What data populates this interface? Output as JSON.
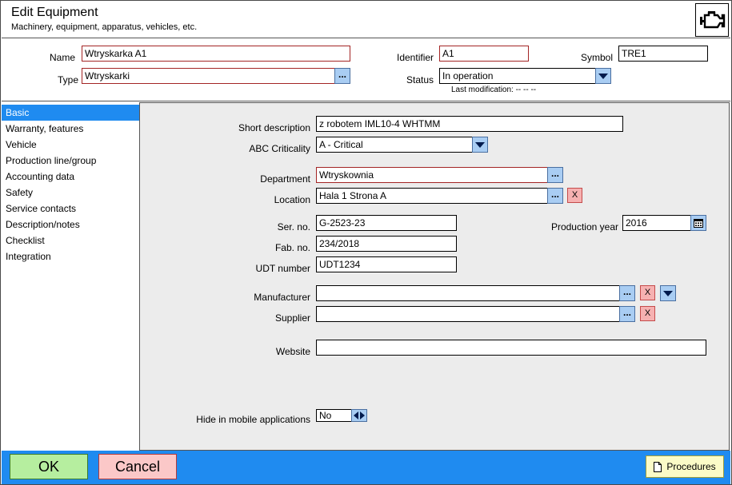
{
  "header": {
    "title": "Edit Equipment",
    "subtitle": "Machinery, equipment, apparatus, vehicles, etc.",
    "icon": "engine-icon"
  },
  "top_form": {
    "name_label": "Name",
    "name_value": "Wtryskarka A1",
    "type_label": "Type",
    "type_value": "Wtryskarki",
    "identifier_label": "Identifier",
    "identifier_value": "A1",
    "symbol_label": "Symbol",
    "symbol_value": "TRE1",
    "status_label": "Status",
    "status_value": "In operation",
    "last_modification": "Last modification: -- -- --"
  },
  "sidebar": {
    "items": [
      {
        "label": "Basic",
        "active": true
      },
      {
        "label": "Warranty, features",
        "active": false
      },
      {
        "label": "Vehicle",
        "active": false
      },
      {
        "label": "Production line/group",
        "active": false
      },
      {
        "label": "Accounting data",
        "active": false
      },
      {
        "label": "Safety",
        "active": false
      },
      {
        "label": "Service contacts",
        "active": false
      },
      {
        "label": "Description/notes",
        "active": false
      },
      {
        "label": "Checklist",
        "active": false
      },
      {
        "label": "Integration",
        "active": false
      }
    ]
  },
  "basic": {
    "short_description_label": "Short description",
    "short_description_value": "z robotem IML10-4  WHTMM",
    "abc_label": "ABC Criticality",
    "abc_value": "A - Critical",
    "department_label": "Department",
    "department_value": "Wtryskownia",
    "location_label": "Location",
    "location_value": "Hala 1 Strona A",
    "serno_label": "Ser. no.",
    "serno_value": "G-2523-23",
    "fabno_label": "Fab. no.",
    "fabno_value": "234/2018",
    "udt_label": "UDT number",
    "udt_value": "UDT1234",
    "production_year_label": "Production year",
    "production_year_value": "2016",
    "manufacturer_label": "Manufacturer",
    "manufacturer_value": "",
    "supplier_label": "Supplier",
    "supplier_value": "",
    "website_label": "Website",
    "website_value": "",
    "hide_label": "Hide in mobile applications",
    "hide_value": "No"
  },
  "buttons": {
    "dots": "...",
    "clear": "X",
    "ok": "OK",
    "cancel": "Cancel",
    "procedures": "Procedures"
  },
  "colors": {
    "accent": "#1f8bf0",
    "ok": "#b6ee9f",
    "cancel": "#fbc8c8",
    "procedures": "#fbfbc7",
    "button_blue": "#a9cdf3",
    "clear_red": "#f6b1b1"
  }
}
